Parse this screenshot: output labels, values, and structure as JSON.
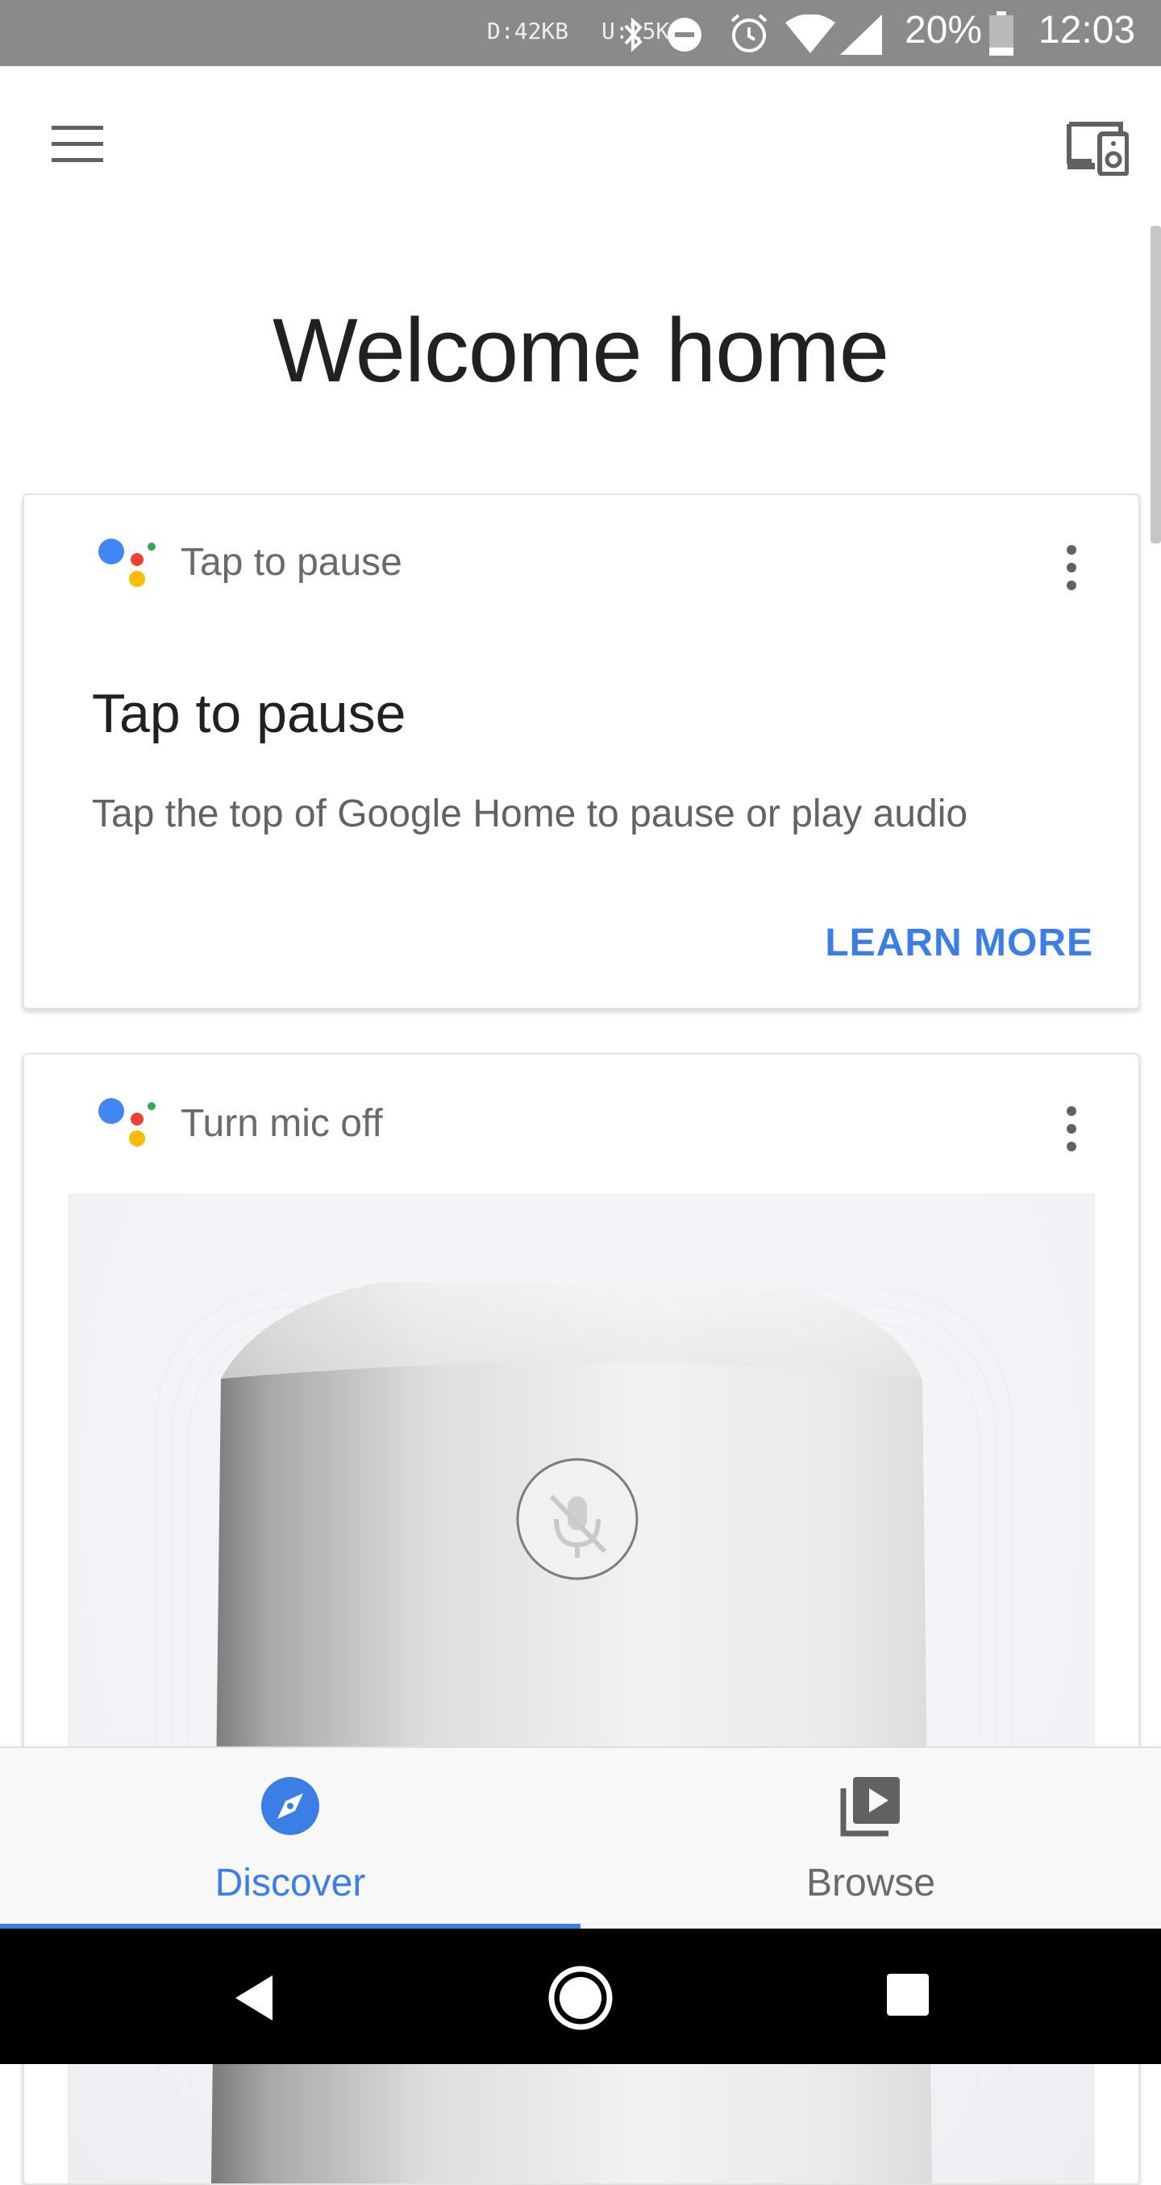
{
  "status_bar": {
    "download": "D:42KB",
    "upload": "U:25K",
    "battery_percent": "20%",
    "time": "12:03"
  },
  "welcome": {
    "title": "Welcome home"
  },
  "cards": [
    {
      "header": "Tap to pause",
      "title": "Tap to pause",
      "body": "Tap the top of Google Home to pause or play audio",
      "action": "LEARN MORE"
    },
    {
      "header": "Turn mic off"
    }
  ],
  "bottom_nav": {
    "items": [
      {
        "label": "Discover",
        "icon": "compass-icon",
        "selected": true
      },
      {
        "label": "Browse",
        "icon": "video-library-icon",
        "selected": false
      }
    ]
  },
  "colors": {
    "accent": "#3b7ee6",
    "status_bar": "#8a8a8a",
    "google_blue": "#4285f4",
    "google_red": "#ea4335",
    "google_yellow": "#fbbc05",
    "google_green": "#34a853"
  }
}
